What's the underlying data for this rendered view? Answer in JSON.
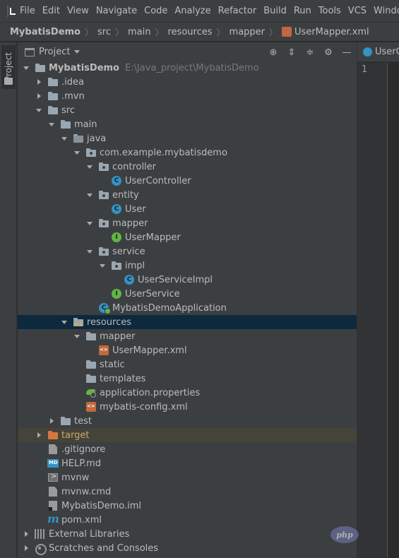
{
  "menubar": {
    "items": [
      "File",
      "Edit",
      "View",
      "Navigate",
      "Code",
      "Analyze",
      "Refactor",
      "Build",
      "Run",
      "Tools",
      "VCS",
      "Window"
    ]
  },
  "breadcrumb": {
    "items": [
      "MybatisDemo",
      "src",
      "main",
      "resources",
      "mapper",
      "UserMapper.xml"
    ]
  },
  "side_stripe": {
    "tab_label": "Project"
  },
  "panel": {
    "title": "Project",
    "actions": [
      "locate-icon",
      "expand-all-icon",
      "collapse-all-icon",
      "gear-icon",
      "minimize-icon"
    ]
  },
  "editor": {
    "tab_label": "UserController",
    "line_number": "1"
  },
  "tree": [
    {
      "label": "MybatisDemo",
      "hint": "E:\\Java_project\\MybatisDemo",
      "depth": 0,
      "arrow": "open",
      "icon": "folder"
    },
    {
      "label": ".idea",
      "depth": 1,
      "arrow": "closed",
      "icon": "folder"
    },
    {
      "label": ".mvn",
      "depth": 1,
      "arrow": "closed",
      "icon": "folder"
    },
    {
      "label": "src",
      "depth": 1,
      "arrow": "open",
      "icon": "folder"
    },
    {
      "label": "main",
      "depth": 2,
      "arrow": "open",
      "icon": "folder"
    },
    {
      "label": "java",
      "depth": 3,
      "arrow": "open",
      "icon": "folder-source"
    },
    {
      "label": "com.example.mybatisdemo",
      "depth": 4,
      "arrow": "open",
      "icon": "package"
    },
    {
      "label": "controller",
      "depth": 5,
      "arrow": "open",
      "icon": "package"
    },
    {
      "label": "UserController",
      "depth": 6,
      "arrow": "none",
      "icon": "class"
    },
    {
      "label": "entity",
      "depth": 5,
      "arrow": "open",
      "icon": "package"
    },
    {
      "label": "User",
      "depth": 6,
      "arrow": "none",
      "icon": "class"
    },
    {
      "label": "mapper",
      "depth": 5,
      "arrow": "open",
      "icon": "package"
    },
    {
      "label": "UserMapper",
      "depth": 6,
      "arrow": "none",
      "icon": "interface"
    },
    {
      "label": "service",
      "depth": 5,
      "arrow": "open",
      "icon": "package"
    },
    {
      "label": "impl",
      "depth": 6,
      "arrow": "open",
      "icon": "package"
    },
    {
      "label": "UserServiceImpl",
      "depth": 7,
      "arrow": "none",
      "icon": "class"
    },
    {
      "label": "UserService",
      "depth": 6,
      "arrow": "none",
      "icon": "interface"
    },
    {
      "label": "MybatisDemoApplication",
      "depth": 5,
      "arrow": "none",
      "icon": "app-class"
    },
    {
      "label": "resources",
      "depth": 3,
      "arrow": "open",
      "icon": "folder-resources",
      "selected": true
    },
    {
      "label": "mapper",
      "depth": 4,
      "arrow": "open",
      "icon": "folder"
    },
    {
      "label": "UserMapper.xml",
      "depth": 5,
      "arrow": "none",
      "icon": "xml"
    },
    {
      "label": "static",
      "depth": 4,
      "arrow": "none",
      "icon": "folder"
    },
    {
      "label": "templates",
      "depth": 4,
      "arrow": "none",
      "icon": "folder"
    },
    {
      "label": "application.properties",
      "depth": 4,
      "arrow": "none",
      "icon": "properties"
    },
    {
      "label": "mybatis-config.xml",
      "depth": 4,
      "arrow": "none",
      "icon": "xml"
    },
    {
      "label": "test",
      "depth": 2,
      "arrow": "closed",
      "icon": "folder"
    },
    {
      "label": "target",
      "depth": 1,
      "arrow": "closed",
      "icon": "folder-excluded",
      "excluded": true
    },
    {
      "label": ".gitignore",
      "depth": 1,
      "arrow": "none",
      "icon": "text"
    },
    {
      "label": "HELP.md",
      "depth": 1,
      "arrow": "none",
      "icon": "markdown"
    },
    {
      "label": "mvnw",
      "depth": 1,
      "arrow": "none",
      "icon": "executable"
    },
    {
      "label": "mvnw.cmd",
      "depth": 1,
      "arrow": "none",
      "icon": "text"
    },
    {
      "label": "MybatisDemo.iml",
      "depth": 1,
      "arrow": "none",
      "icon": "iml"
    },
    {
      "label": "pom.xml",
      "depth": 1,
      "arrow": "none",
      "icon": "maven"
    },
    {
      "label": "External Libraries",
      "depth": 0,
      "arrow": "closed",
      "icon": "libraries"
    },
    {
      "label": "Scratches and Consoles",
      "depth": 0,
      "arrow": "closed",
      "icon": "scratches"
    }
  ],
  "watermark": {
    "text": "php"
  }
}
